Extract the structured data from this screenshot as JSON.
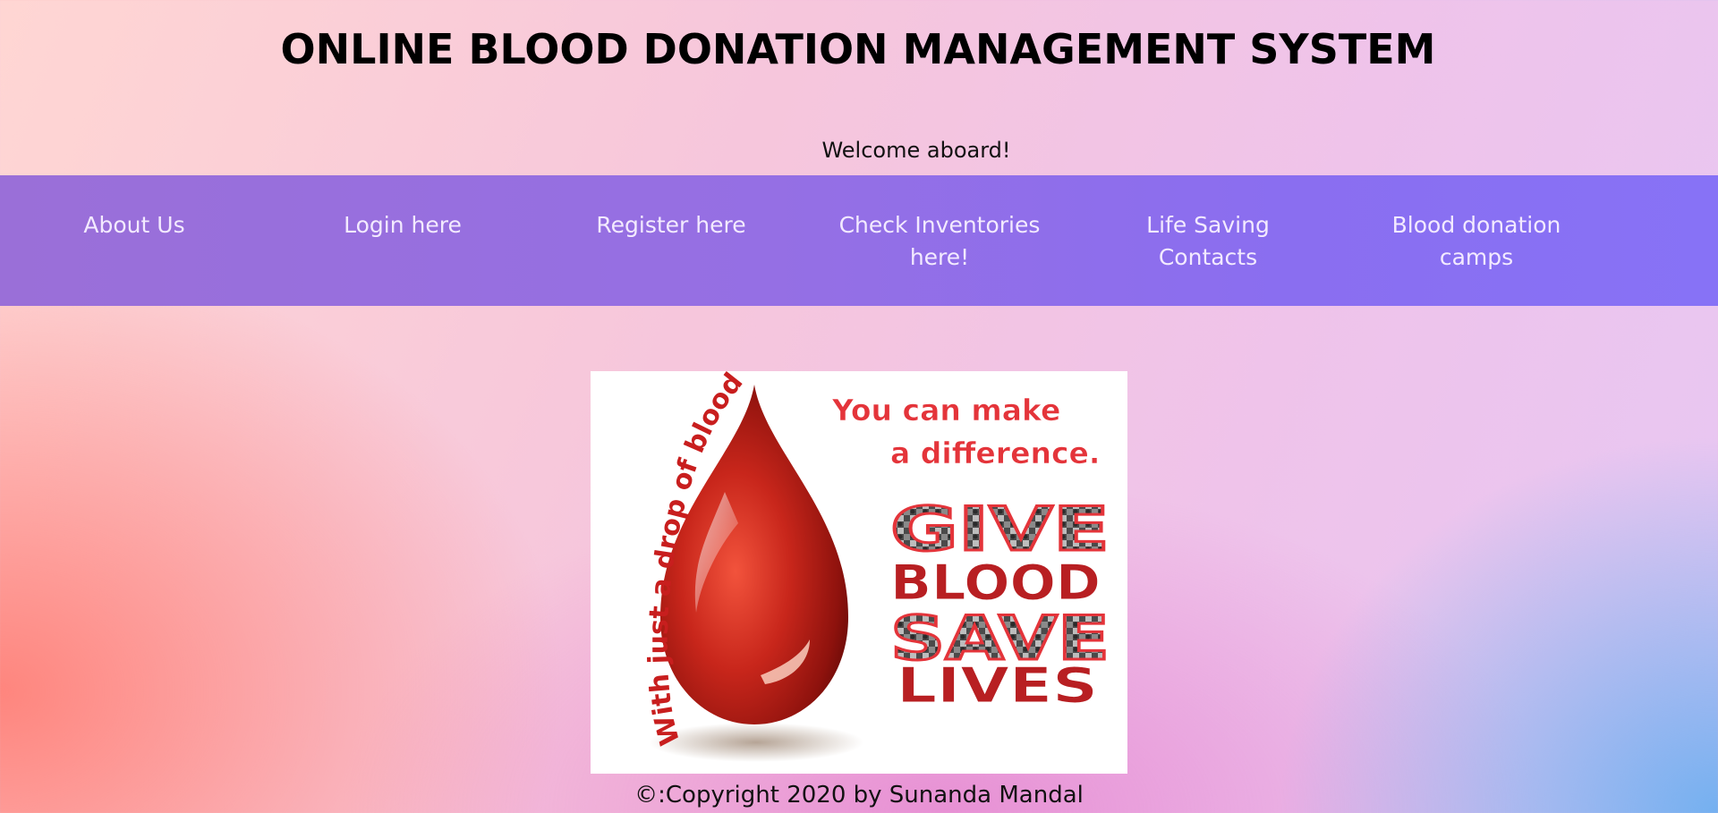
{
  "header": {
    "title": "ONLINE BLOOD DONATION MANAGEMENT SYSTEM",
    "welcome": "Welcome aboard!"
  },
  "nav": {
    "items": [
      {
        "label": "About Us"
      },
      {
        "label": "Login here"
      },
      {
        "label": "Register here"
      },
      {
        "label": "Check Inventories\nhere!"
      },
      {
        "label": "Life Saving\nContacts"
      },
      {
        "label": "Blood donation\ncamps"
      }
    ]
  },
  "hero": {
    "icon": "blood-drop-icon",
    "arc_text": "With just a drop of blood,",
    "line1": "You can make",
    "line2": "a difference.",
    "word1": "GIVE",
    "word2": "BLOOD",
    "word3": "SAVE",
    "word4": "LIVES"
  },
  "footer": {
    "copyright": "©:Copyright 2020 by Sunanda Mandal"
  },
  "colors": {
    "nav_bg": "#956fe4",
    "nav_text": "#f3eaff",
    "blood_red": "#c2231c",
    "poster_text_red": "#e4343a"
  }
}
